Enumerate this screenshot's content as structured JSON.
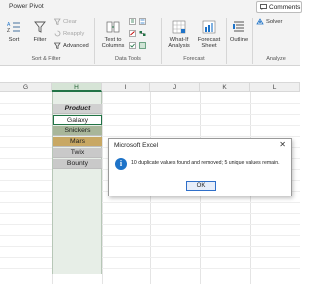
{
  "ribbon": {
    "tab_power_pivot": "Power Pivot",
    "comments_label": "Comments",
    "sort_label": "Sort",
    "filter_label": "Filter",
    "clear_label": "Clear",
    "reapply_label": "Reapply",
    "advanced_label": "Advanced",
    "text_to_columns_line1": "Text to",
    "text_to_columns_line2": "Columns",
    "whatif_line1": "What-If",
    "whatif_line2": "Analysis",
    "forecast_line1": "Forecast",
    "forecast_line2": "Sheet",
    "outline_label": "Outline",
    "solver_label": "Solver",
    "groups": {
      "sort_filter": "Sort & Filter",
      "data_tools": "Data Tools",
      "forecast": "Forecast",
      "analyze": "Analyze"
    }
  },
  "sheet": {
    "columns": [
      "G",
      "H",
      "I",
      "J",
      "K",
      "L"
    ],
    "selected_column": "H",
    "cells": [
      {
        "text": "Product",
        "fill": "#d0d0d0"
      },
      {
        "text": "Galaxy",
        "fill": "#ffffff"
      },
      {
        "text": "Snickers",
        "fill": "#a8b69a"
      },
      {
        "text": "Mars",
        "fill": "#c8a864"
      },
      {
        "text": "Twix",
        "fill": "#c9c9c9"
      },
      {
        "text": "Bounty",
        "fill": "#c9c9c9"
      }
    ]
  },
  "dialog": {
    "title": "Microsoft Excel",
    "message": "10 duplicate values found and removed; 5 unique values remain.",
    "ok_label": "OK"
  },
  "colors": {
    "accent_green": "#217346",
    "info_blue": "#1e73c8"
  }
}
